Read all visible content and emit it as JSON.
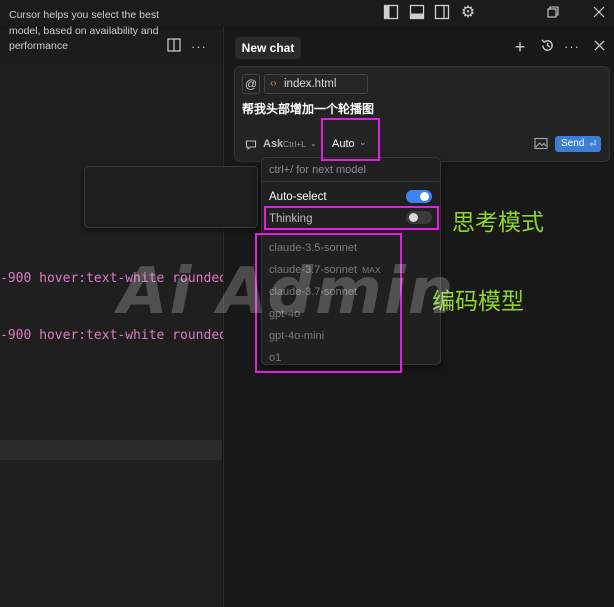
{
  "editor": {
    "code_lines": [
      "-900 hover:text-white rounded",
      "-900 hover:text-white rounded"
    ]
  },
  "tooltip": {
    "text": "Cursor helps you select the best model, based on availability and performance"
  },
  "chat": {
    "tab_label": "New chat",
    "icons": [
      "plus-icon",
      "history-icon",
      "more-icon",
      "close-icon"
    ]
  },
  "composer": {
    "at_symbol": "@",
    "file_chip_label": "index.html",
    "prompt_text": "帮我头部增加一个轮播图",
    "ask_label": "Ask",
    "ask_hint": "Ctrl+L",
    "model_selector_label": "Auto",
    "send_label": "Send"
  },
  "model_dropdown": {
    "hint": "ctrl+/ for next model",
    "auto_select_label": "Auto-select",
    "auto_select_enabled": true,
    "thinking_label": "Thinking",
    "thinking_enabled": false,
    "models": [
      {
        "name": "claude-3.5-sonnet",
        "badge": ""
      },
      {
        "name": "claude-3.7-sonnet",
        "badge": "MAX"
      },
      {
        "name": "claude-3.7-sonnet",
        "badge": ""
      },
      {
        "name": "gpt-4o",
        "badge": ""
      },
      {
        "name": "gpt-4o-mini",
        "badge": ""
      },
      {
        "name": "o1",
        "badge": ""
      }
    ]
  },
  "annotations": {
    "thinking_mode": "思考模式",
    "coding_model": "编码模型",
    "highlight_color": "#e020e0",
    "text_color": "#8fd62a"
  },
  "watermark": "Ai Admin",
  "colors": {
    "accent": "#3b82f6",
    "code_text": "#e07ac6",
    "background": "#181818"
  }
}
